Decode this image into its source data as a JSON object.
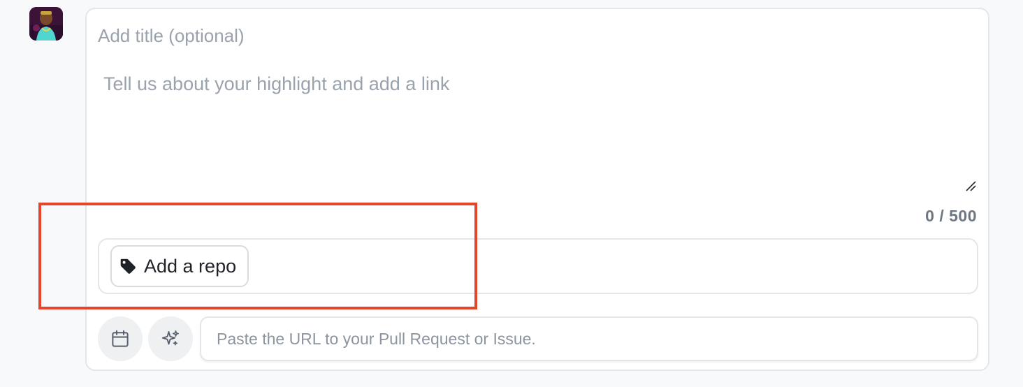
{
  "composer": {
    "title_placeholder": "Add title (optional)",
    "title_value": "",
    "body_placeholder": "Tell us about your highlight and add a link",
    "body_value": "",
    "char_count": "0 / 500",
    "add_repo_label": "Add a repo",
    "url_placeholder": "Paste the URL to your Pull Request or Issue.",
    "url_value": ""
  },
  "icons": {
    "avatar": "user-avatar",
    "tag": "tag-icon",
    "calendar": "calendar-icon",
    "sparkles": "sparkles-icon",
    "resize": "resize-grip-icon"
  },
  "colors": {
    "highlight_outline": "#e5452d",
    "border": "#e3e6ea",
    "placeholder": "#9aa3ad",
    "button_bg": "#eef0f2"
  }
}
